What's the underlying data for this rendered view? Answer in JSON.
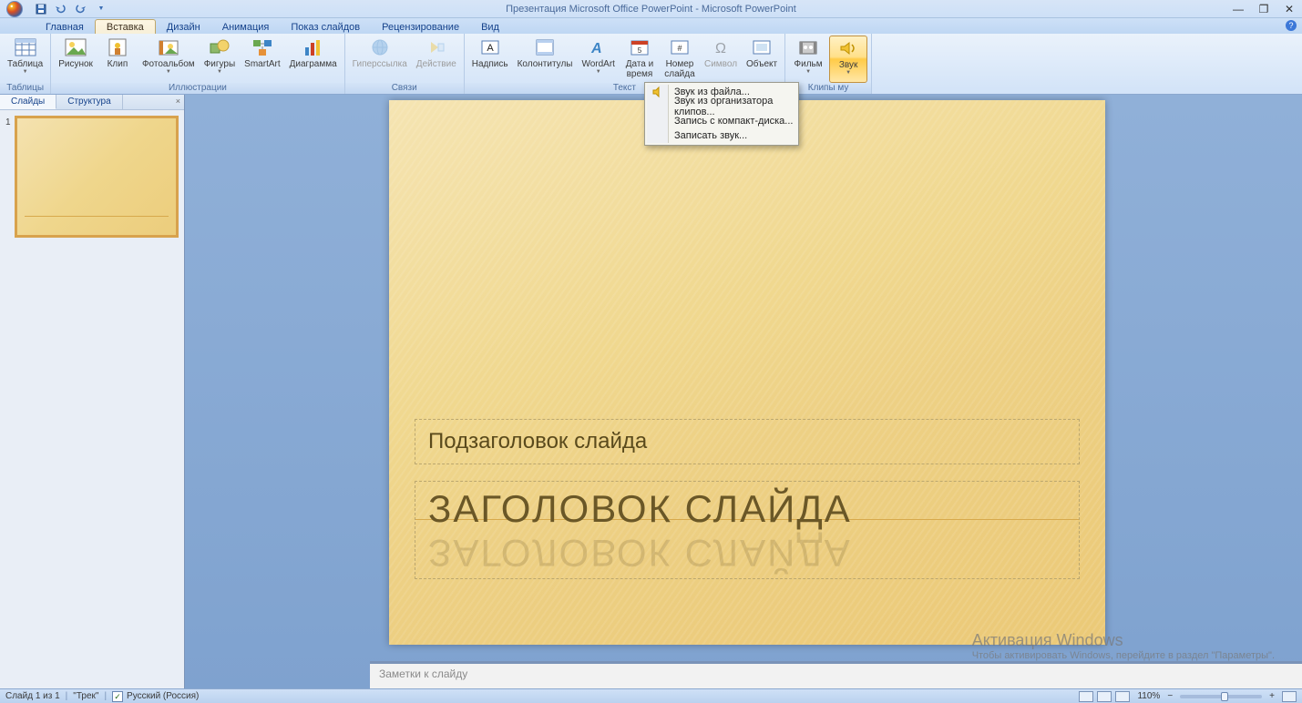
{
  "title": "Презентация Microsoft Office PowerPoint - Microsoft PowerPoint",
  "tabs": [
    "Главная",
    "Вставка",
    "Дизайн",
    "Анимация",
    "Показ слайдов",
    "Рецензирование",
    "Вид"
  ],
  "active_tab_index": 1,
  "ribbon": {
    "groups": [
      {
        "label": "Таблицы",
        "buttons": [
          {
            "name": "table",
            "label": "Таблица",
            "dropdown": true
          }
        ]
      },
      {
        "label": "Иллюстрации",
        "buttons": [
          {
            "name": "picture",
            "label": "Рисунок"
          },
          {
            "name": "clip",
            "label": "Клип"
          },
          {
            "name": "photoalbum",
            "label": "Фотоальбом",
            "dropdown": true
          },
          {
            "name": "shapes",
            "label": "Фигуры",
            "dropdown": true
          },
          {
            "name": "smartart",
            "label": "SmartArt"
          },
          {
            "name": "chart",
            "label": "Диаграмма"
          }
        ]
      },
      {
        "label": "Связи",
        "buttons": [
          {
            "name": "hyperlink",
            "label": "Гиперссылка",
            "disabled": true
          },
          {
            "name": "action",
            "label": "Действие",
            "disabled": true
          }
        ]
      },
      {
        "label": "Текст",
        "buttons": [
          {
            "name": "textbox",
            "label": "Надпись"
          },
          {
            "name": "headerfooter",
            "label": "Колонтитулы"
          },
          {
            "name": "wordart",
            "label": "WordArt",
            "dropdown": true
          },
          {
            "name": "datetime",
            "label": "Дата и\nвремя"
          },
          {
            "name": "slidenumber",
            "label": "Номер\nслайда"
          },
          {
            "name": "symbol",
            "label": "Символ",
            "disabled": true
          },
          {
            "name": "object",
            "label": "Объект"
          }
        ]
      },
      {
        "label": "Клипы мультимедиа",
        "short_label": "Клипы му",
        "buttons": [
          {
            "name": "movie",
            "label": "Фильм",
            "dropdown": true
          },
          {
            "name": "sound",
            "label": "Звук",
            "dropdown": true,
            "active": true
          }
        ]
      }
    ]
  },
  "sound_menu": [
    "Звук из файла...",
    "Звук из организатора клипов...",
    "Запись с компакт-диска...",
    "Записать звук..."
  ],
  "side_tabs": [
    "Слайды",
    "Структура"
  ],
  "slide": {
    "number": "1",
    "subtitle": "Подзаголовок слайда",
    "title": "ЗАГОЛОВОК СЛАЙДА"
  },
  "notes_placeholder": "Заметки к слайду",
  "watermark": {
    "line1": "Активация Windows",
    "line2": "Чтобы активировать Windows, перейдите в раздел \"Параметры\"."
  },
  "status": {
    "slide_counter": "Слайд 1 из 1",
    "theme": "\"Трек\"",
    "language": "Русский (Россия)",
    "zoom": "110%"
  }
}
